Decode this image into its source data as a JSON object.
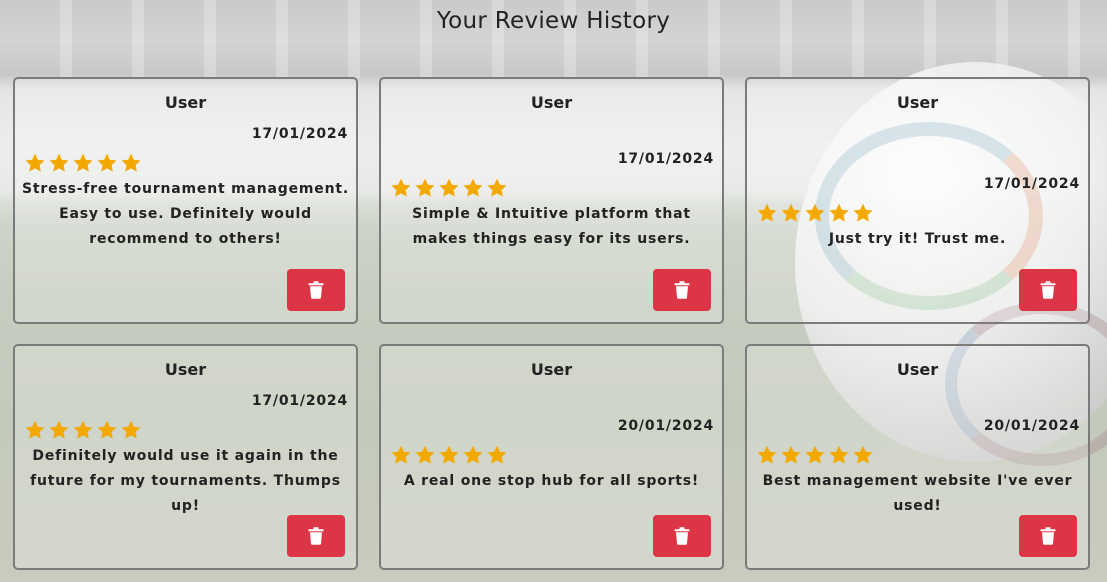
{
  "page": {
    "title": "Your Review History"
  },
  "colors": {
    "star": "#f4a900",
    "delete_button": "#dc3545"
  },
  "icons": {
    "rating": "star-icon",
    "delete": "trash-icon"
  },
  "reviews": [
    {
      "user": "User",
      "date": "17/01/2024",
      "rating": 5,
      "text": "Stress-free tournament management. Easy to use. Definitely would recommend to others!"
    },
    {
      "user": "User",
      "date": "17/01/2024",
      "rating": 5,
      "text": "Simple & Intuitive platform that makes things easy for its users."
    },
    {
      "user": "User",
      "date": "17/01/2024",
      "rating": 5,
      "text": "Just try it! Trust me."
    },
    {
      "user": "User",
      "date": "17/01/2024",
      "rating": 5,
      "text": "Definitely would use it again in the future for my tournaments. Thumps up!"
    },
    {
      "user": "User",
      "date": "20/01/2024",
      "rating": 5,
      "text": "A real one stop hub for all sports!"
    },
    {
      "user": "User",
      "date": "20/01/2024",
      "rating": 5,
      "text": "Best management website I've ever used!"
    }
  ]
}
